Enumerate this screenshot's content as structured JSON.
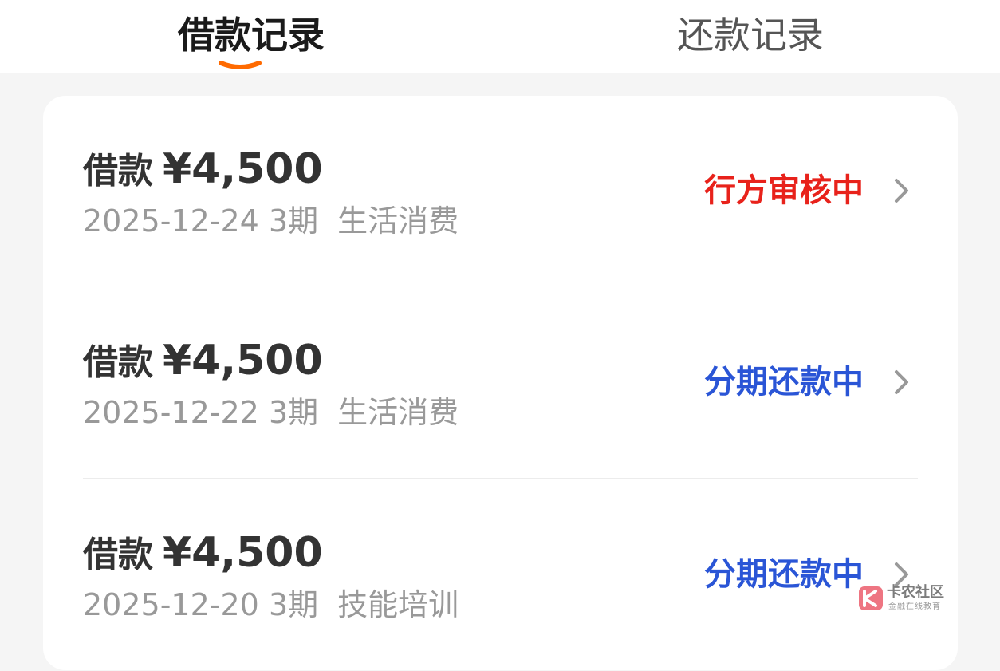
{
  "tabs": {
    "borrow_records": "借款记录",
    "repay_records": "还款记录",
    "active": "借款记录"
  },
  "colors": {
    "accent": "#ff6a00",
    "status_review": "#e8221b",
    "status_repaying": "#2a55d6"
  },
  "records": [
    {
      "label": "借款",
      "amount": "¥4,500",
      "date": "2025-12-24",
      "term": "3期",
      "purpose": "生活消费",
      "status": "行方审核中"
    },
    {
      "label": "借款",
      "amount": "¥4,500",
      "date": "2025-12-22",
      "term": "3期",
      "purpose": "生活消费",
      "status": "分期还款中"
    },
    {
      "label": "借款",
      "amount": "¥4,500",
      "date": "2025-12-20",
      "term": "3期",
      "purpose": "技能培训",
      "status": "分期还款中"
    }
  ],
  "icons": {
    "row_arrow": "chevron-right-icon",
    "watermark_logo": "kanong-logo-icon"
  },
  "watermark": {
    "title": "卡农社区",
    "subtitle": "金融在线教育"
  }
}
